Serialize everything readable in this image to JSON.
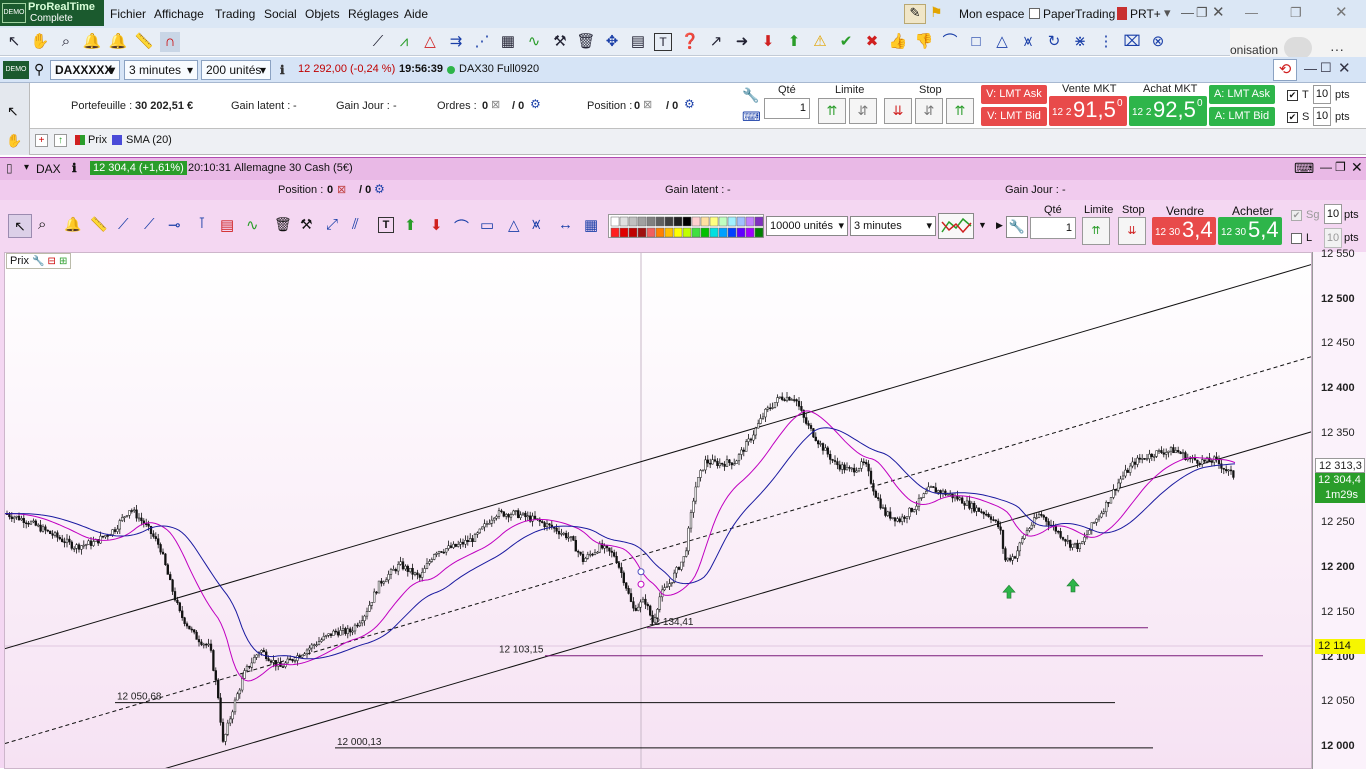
{
  "app": {
    "logo_line1": "ProRealTime",
    "logo_line2": "Complete",
    "logo_demo": "DEMO",
    "menu": [
      "Fichier",
      "Affichage",
      "Trading",
      "Social",
      "Objets",
      "Réglages",
      "Aide"
    ],
    "workspace_label": "Mon espace",
    "papertrading_label": "PaperTrading",
    "prt_label": "PRT+",
    "browser_partial": "onisation"
  },
  "instrument_bar": {
    "ticker": "DAXXXXX",
    "timeframe": "3 minutes",
    "units": "200 unités",
    "price_change": "12 292,00 (-0,24 %)",
    "time": "19:56:39",
    "feed": "DAX30 Full0920"
  },
  "portfolio": {
    "portefeuille_label": "Portefeuille :",
    "portefeuille_value": "30 202,51 €",
    "gain_latent_label": "Gain latent :",
    "gain_latent_value": "-",
    "gain_jour_label": "Gain Jour :",
    "gain_jour_value": "-",
    "ordres_label": "Ordres :",
    "ordres_a": "0",
    "ordres_b": "/ 0",
    "position_label": "Position :",
    "position_a": "0",
    "position_b": "/ 0",
    "qte_label": "Qté",
    "qte_value": "1",
    "limite_label": "Limite",
    "stop_label": "Stop",
    "v_lmt_ask": "V: LMT Ask",
    "v_lmt_bid": "V: LMT Bid",
    "vente_mkt_label": "Vente MKT",
    "vente_mkt_prefix": "12 2",
    "vente_mkt_big": "91,5",
    "vente_mkt_sup": "0",
    "achat_mkt_label": "Achat MKT",
    "achat_mkt_prefix": "12 2",
    "achat_mkt_big": "92,5",
    "achat_mkt_sup": "0",
    "a_lmt_ask": "A: LMT Ask",
    "a_lmt_bid": "A: LMT Bid",
    "t_label": "T",
    "t_value": "10",
    "s_label": "S",
    "s_value": "10",
    "pts": "pts"
  },
  "indicators": {
    "prix_label": "Prix",
    "sma_label": "SMA (20)"
  },
  "chart_window": {
    "title": "DAX",
    "quote": "12 304,4 (+1,61%)",
    "quote_time": "20:10:31",
    "instrument_name": "Allemagne 30 Cash (5€)",
    "position_label": "Position :",
    "position_a": "0",
    "position_b": "/ 0",
    "gain_latent_label": "Gain latent :",
    "gain_latent_value": "-",
    "gain_jour_label": "Gain Jour :",
    "gain_jour_value": "-",
    "units_select": "10000 unités",
    "tf_select": "3 minutes",
    "qte_label": "Qté",
    "qte_value": "1",
    "limite_label": "Limite",
    "stop_label": "Stop",
    "vendre_label": "Vendre",
    "vendre_prefix": "12 30",
    "vendre_big": "3,4",
    "acheter_label": "Acheter",
    "acheter_prefix": "12 30",
    "acheter_big": "5,4",
    "sg_label": "Sg",
    "sg_value": "10",
    "l_label": "L",
    "l_value": "10",
    "pts": "pts",
    "prix_tag": "Prix",
    "y_axis": [
      "12 550",
      "12 500",
      "12 450",
      "12 400",
      "12 350",
      "12 300",
      "12 250",
      "12 200",
      "12 150",
      "12 100",
      "12 050",
      "12 000"
    ],
    "tag_last": "12 313,3",
    "tag_price": "12 304,4",
    "tag_timer": "1m29s",
    "tag_cursor": "12 114",
    "level_labels": [
      "12 134,41",
      "12 103,15",
      "12 050,68",
      "12 000,13"
    ]
  },
  "colors": {
    "accent_red": "#e84a4a",
    "accent_green": "#2eb54a",
    "chart_bg": "#f4d7f2",
    "sma_fast": "#c000c0",
    "sma_slow": "#1a1aa0"
  }
}
